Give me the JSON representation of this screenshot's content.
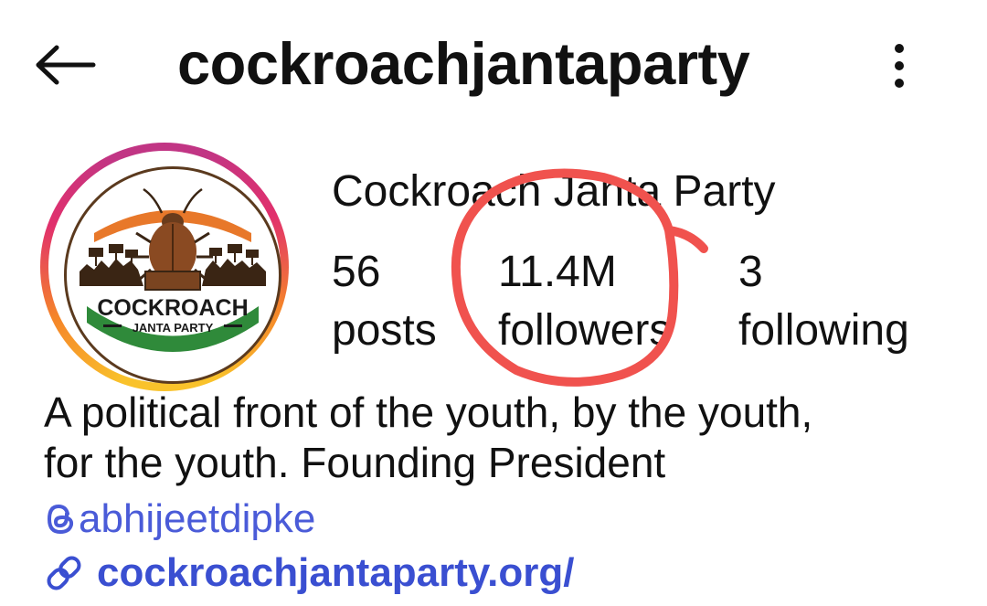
{
  "header": {
    "back_icon": "arrow-left-icon",
    "title": "cockroachjantaparty",
    "more_icon": "more-vertical-icon"
  },
  "avatar": {
    "logo_text_main": "COCKROACH",
    "logo_text_sub": "JANTA PARTY",
    "ring_colors": [
      "#f9c22b",
      "#f58529",
      "#e1306c",
      "#c13584"
    ],
    "logo_colors": {
      "saffron": "#e8782a",
      "green": "#2f8a3a",
      "text": "#1a1a1a"
    }
  },
  "profile": {
    "display_name": "Cockroach Janta Party",
    "stats": [
      {
        "value": "56",
        "label": "posts"
      },
      {
        "value": "11.4M",
        "label": "followers"
      },
      {
        "value": "3",
        "label": "following"
      }
    ]
  },
  "bio": {
    "line1": "A political front of the youth, by the youth,",
    "line2": "for the youth. Founding President",
    "threads_handle": "abhijeetdipke",
    "threads_icon": "threads-icon",
    "link_icon": "link-icon",
    "link_text": "cockroachjantaparty.org/"
  },
  "annotation": {
    "type": "red-hand-drawn-circle",
    "color": "#f0524e",
    "target": "followers"
  }
}
